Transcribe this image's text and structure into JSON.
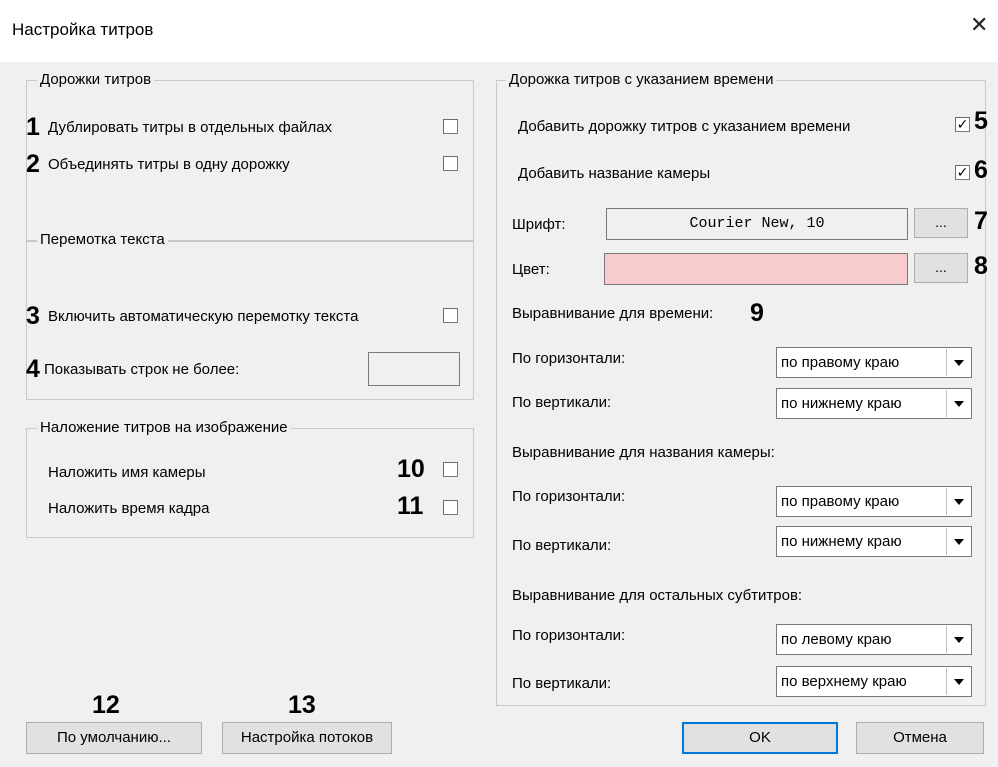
{
  "dialog": {
    "title": "Настройка титров",
    "close_glyph": "✕"
  },
  "tracks": {
    "label": "Дорожки титров",
    "duplicate": {
      "num": "1",
      "label": "Дублировать титры в отдельных файлах",
      "checked": false
    },
    "merge": {
      "num": "2",
      "label": "Объединять титры в одну дорожку",
      "checked": false
    }
  },
  "scroll": {
    "label": "Перемотка текста",
    "auto": {
      "num": "3",
      "label": "Включить автоматическую перемотку текста",
      "checked": false
    },
    "max_lines": {
      "num": "4",
      "label": "Показывать строк не более:",
      "value": ""
    }
  },
  "overlay": {
    "label": "Наложение титров на изображение",
    "camera": {
      "num": "10",
      "label": "Наложить имя камеры",
      "checked": false
    },
    "frame_time": {
      "num": "11",
      "label": "Наложить время кадра",
      "checked": false
    }
  },
  "timed_track": {
    "label": "Дорожка титров с указанием времени",
    "add_track": {
      "num": "5",
      "label": "Добавить дорожку титров с указанием времени",
      "checked": true
    },
    "add_camera_name": {
      "num": "6",
      "label": "Добавить название камеры",
      "checked": true
    },
    "font": {
      "num": "7",
      "label": "Шрифт:",
      "value": "Courier New, 10",
      "button": "..."
    },
    "color": {
      "num": "8",
      "label": "Цвет:",
      "value": "#f8cccc",
      "button": "..."
    },
    "time_align": {
      "num": "9",
      "label": "Выравнивание для времени:",
      "horizontal_label": "По горизонтали:",
      "horizontal": "по правому краю",
      "vertical_label": "По вертикали:",
      "vertical": "по нижнему краю"
    },
    "camera_align": {
      "label": "Выравнивание для названия камеры:",
      "horizontal_label": "По горизонтали:",
      "horizontal": "по правому краю",
      "vertical_label": "По вертикали:",
      "vertical": "по нижнему краю"
    },
    "other_align": {
      "label": "Выравнивание для остальных субтитров:",
      "horizontal_label": "По горизонтали:",
      "horizontal": "по левому краю",
      "vertical_label": "По вертикали:",
      "vertical": "по верхнему краю"
    }
  },
  "footer": {
    "defaults": {
      "num": "12",
      "label": "По умолчанию..."
    },
    "streams": {
      "num": "13",
      "label": "Настройка потоков"
    },
    "ok": "OK",
    "cancel": "Отмена"
  },
  "colors": {
    "accent": "#0078d7",
    "color_swatch": "#f8cccc",
    "window_bg": "#f0f0f0"
  }
}
